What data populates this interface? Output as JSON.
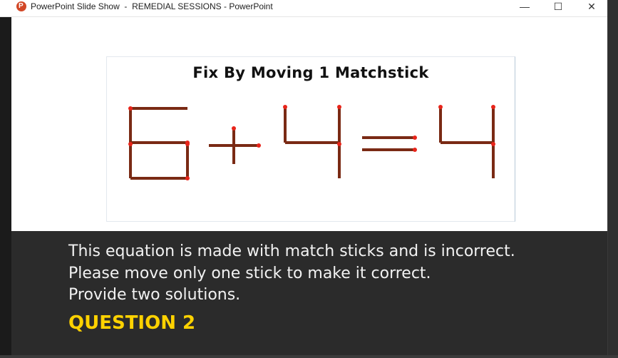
{
  "window": {
    "title": "PowerPoint Slide Show  -  REMEDIAL SESSIONS - PowerPoint",
    "app_icon_letter": "P",
    "minimize_label": "—",
    "maximize_label": "☐",
    "close_label": "✕"
  },
  "slide": {
    "puzzle_title": "Fix By Moving 1 Matchstick",
    "equation": "6+4=4",
    "caption_lines": [
      "This equation is made with match sticks and is incorrect.",
      "Please move only one stick to make it correct.",
      "Provide two solutions."
    ],
    "question_label": "QUESTION 2"
  },
  "colors": {
    "match_stick": "#7a2a14",
    "match_head": "#e8241a",
    "question_label": "#ffd200",
    "caption_bg": "#2b2b2b"
  }
}
